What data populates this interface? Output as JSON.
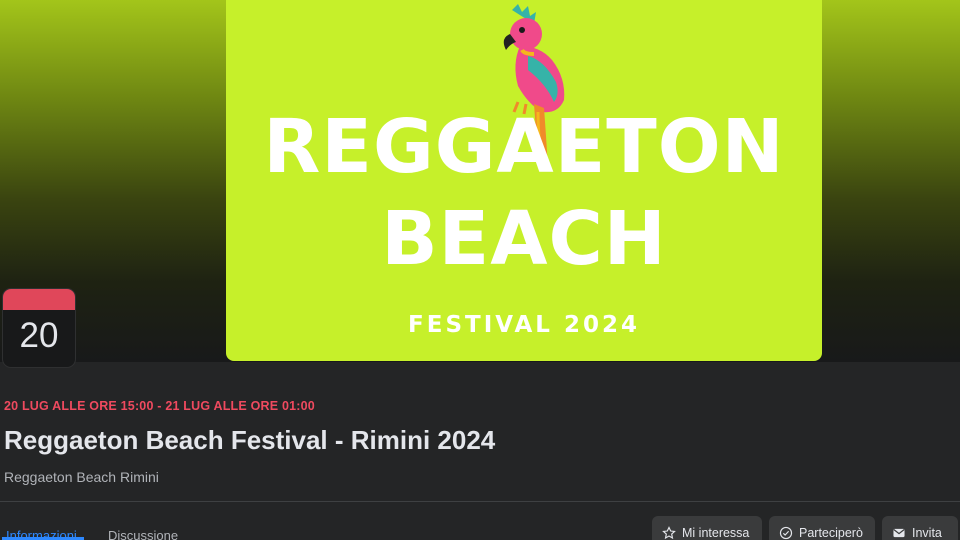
{
  "cover": {
    "poster": {
      "line1": "REGGAETON",
      "line2": "BEACH",
      "subtitle": "FESTIVAL 2024",
      "logo_icon": "parrot-icon"
    },
    "colors": {
      "poster_bg": "#c6f02a",
      "poster_text": "#ffffff"
    }
  },
  "event": {
    "date_badge_day": "20",
    "when": "20 LUG ALLE ORE 15:00 - 21 LUG ALLE ORE 01:00",
    "title": "Reggaeton Beach Festival - Rimini 2024",
    "host": "Reggaeton Beach Rimini"
  },
  "tabs": [
    {
      "label": "Informazioni",
      "active": true
    },
    {
      "label": "Discussione",
      "active": false
    }
  ],
  "actions": {
    "interested": {
      "label": "Mi interessa",
      "icon": "star-icon"
    },
    "going": {
      "label": "Parteciperò",
      "icon": "check-circle-icon"
    },
    "invite": {
      "label": "Invita",
      "icon": "envelope-icon"
    }
  },
  "colors": {
    "accent_date": "#ef4a5f",
    "tab_active": "#2d88ff",
    "page_bg": "#242526"
  }
}
